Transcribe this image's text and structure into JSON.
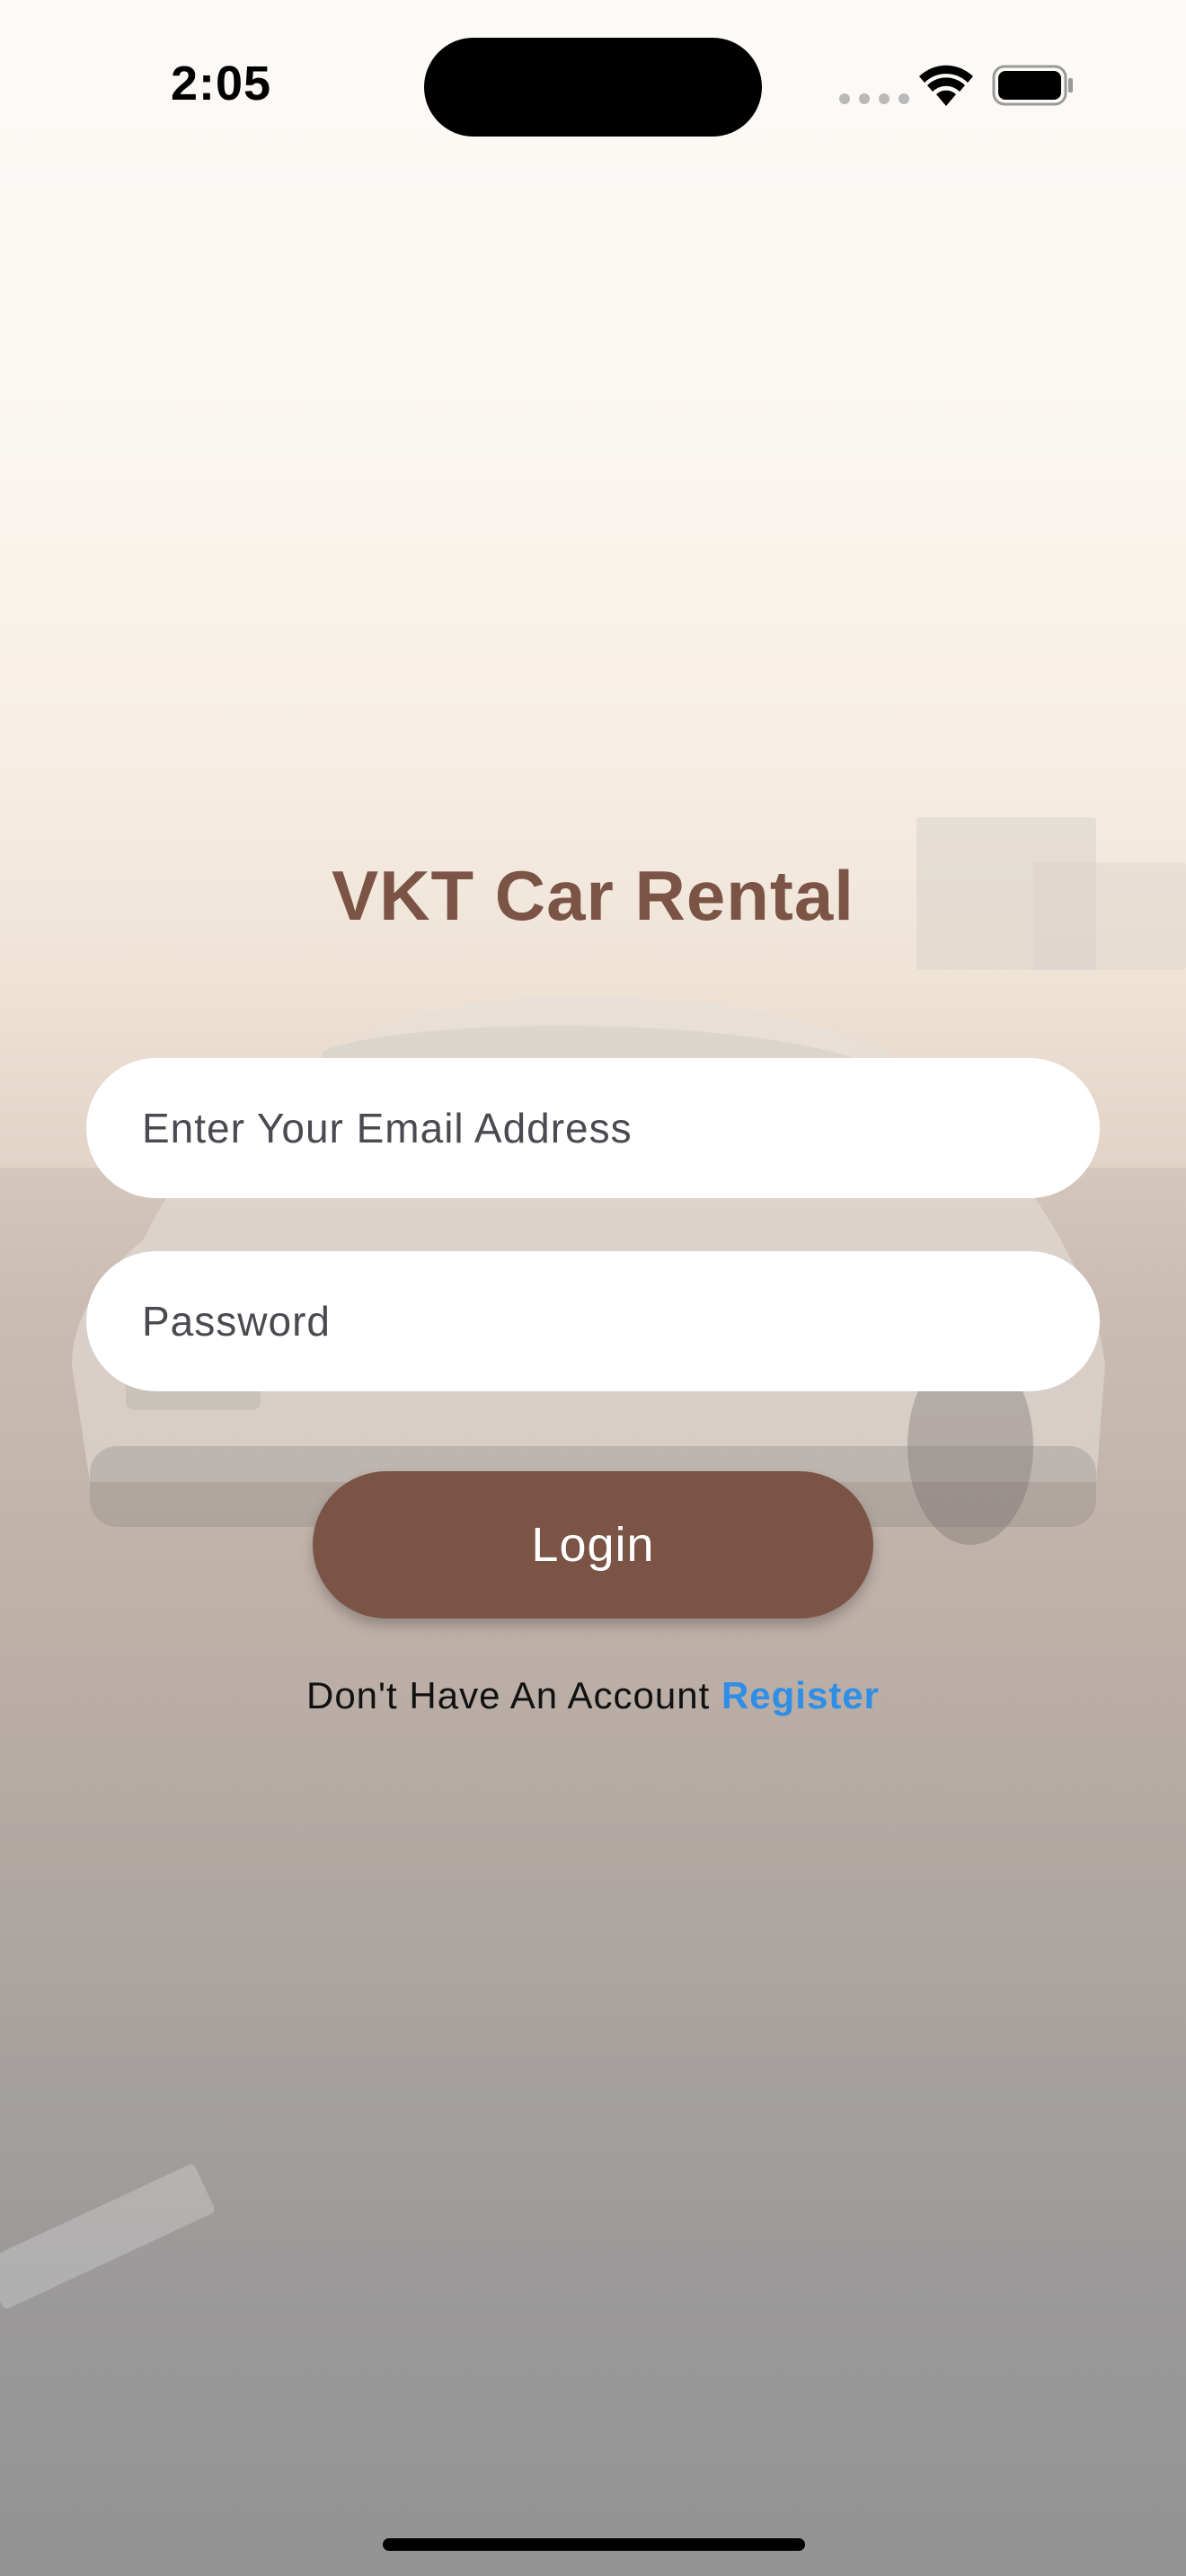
{
  "status_bar": {
    "time": "2:05"
  },
  "app": {
    "title": "VKT Car Rental"
  },
  "form": {
    "email_placeholder": "Enter Your Email Address",
    "email_value": "",
    "password_placeholder": "Password",
    "password_value": "",
    "login_label": "Login"
  },
  "footer": {
    "prompt_text": "Don't Have An Account",
    "register_label": "Register"
  },
  "colors": {
    "accent": "#7b5446",
    "link": "#2f8ee6",
    "field_bg": "#ffffff"
  },
  "icons": [
    "wifi-icon",
    "battery-icon",
    "signal-icon"
  ]
}
